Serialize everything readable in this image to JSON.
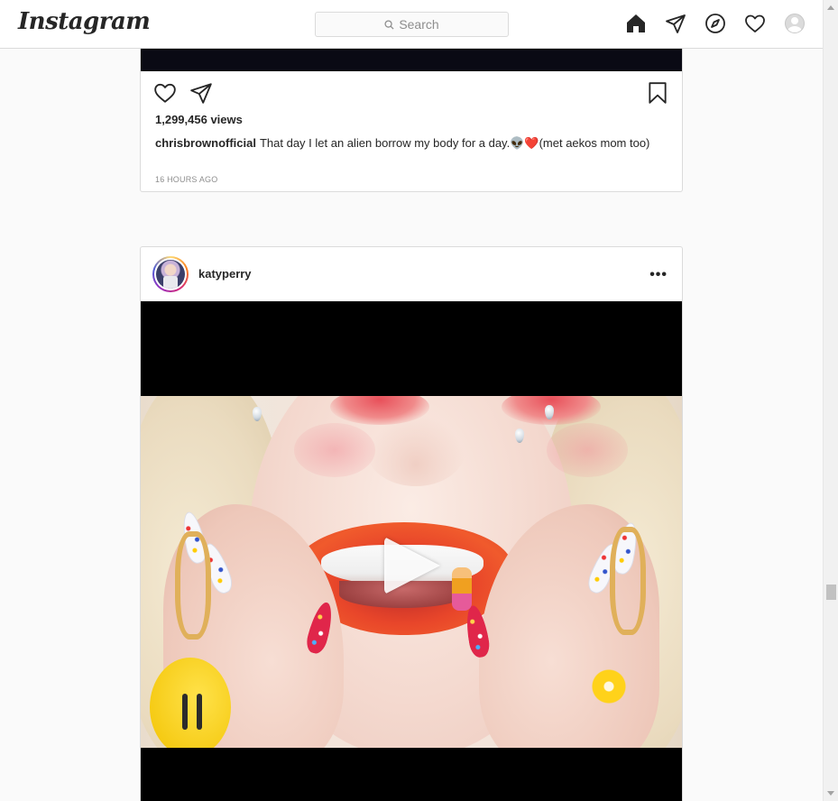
{
  "nav": {
    "logo": "Instagram",
    "search_placeholder": "Search",
    "icons": [
      "home-icon",
      "direct-icon",
      "explore-icon",
      "activity-icon",
      "profile-avatar"
    ]
  },
  "post1": {
    "views": "1,299,456 views",
    "username": "chrisbrownofficial",
    "caption": "That day I let an alien borrow my body for a day.👽❤️(met aekos mom too)",
    "time": "16 HOURS AGO"
  },
  "post2": {
    "username": "katyperry",
    "more": "•••"
  },
  "colors": {
    "border": "#dbdbdb",
    "text": "#262626",
    "muted": "#8e8e8e",
    "background": "#fafafa"
  }
}
